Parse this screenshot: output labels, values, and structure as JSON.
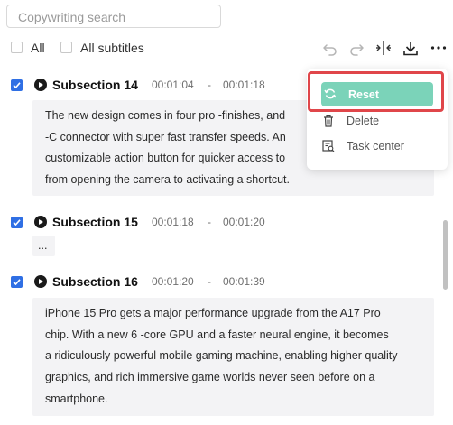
{
  "search": {
    "placeholder": "Copywriting search"
  },
  "filters": {
    "all_label": "All",
    "all_subtitles_label": "All subtitles"
  },
  "toolbar": {
    "icons": [
      "undo-icon",
      "redo-icon",
      "split-icon",
      "download-icon",
      "more-icon"
    ]
  },
  "menu": {
    "items": [
      {
        "label": "Reset",
        "icon": "reset-icon"
      },
      {
        "label": "Delete",
        "icon": "trash-icon"
      },
      {
        "label": "Task center",
        "icon": "task-center-icon"
      }
    ]
  },
  "sections": [
    {
      "title": "Subsection 14",
      "start": "00:01:04",
      "sep": "-",
      "end": "00:01:18",
      "checked": true,
      "lines": [
        "The new design comes in four pro -finishes, and",
        "-C connector with super fast transfer speeds. An",
        "customizable action button for quicker access to",
        "from opening the camera to activating a shortcut."
      ]
    },
    {
      "title": "Subsection 15",
      "start": "00:01:18",
      "sep": "-",
      "end": "00:01:20",
      "checked": true,
      "lines": [
        "..."
      ]
    },
    {
      "title": "Subsection 16",
      "start": "00:01:20",
      "sep": "-",
      "end": "00:01:39",
      "checked": true,
      "lines": [
        "iPhone 15 Pro gets a major performance upgrade from the A17 Pro",
        "chip. With a new 6 -core GPU and a faster neural engine, it becomes",
        "a ridiculously powerful mobile gaming machine, enabling higher quality",
        "graphics, and rich immersive game worlds never seen before on a",
        "smartphone."
      ]
    }
  ],
  "colors": {
    "accent": "#2f6fe4",
    "reset": "#7bd3b9",
    "highlight": "#e0464a"
  }
}
